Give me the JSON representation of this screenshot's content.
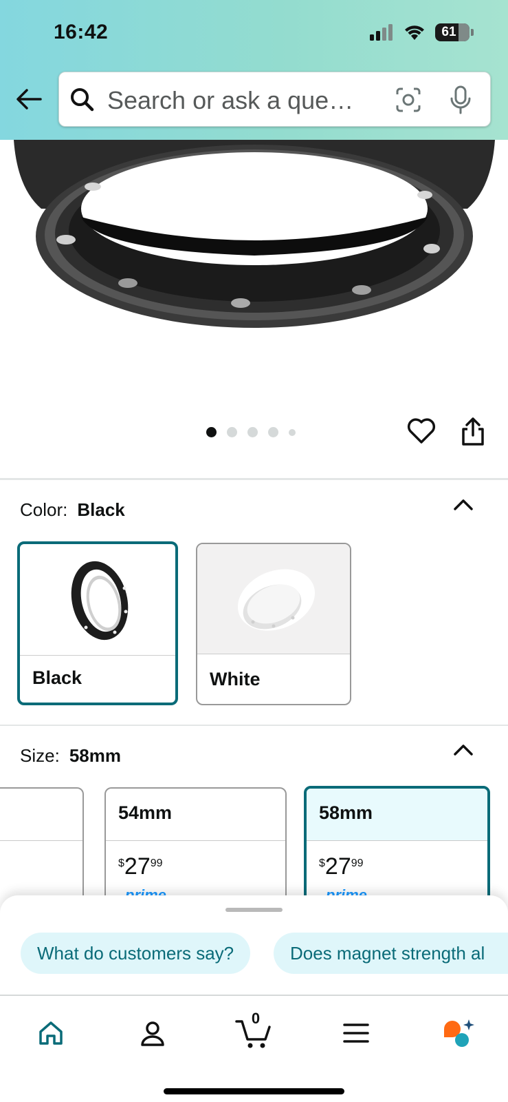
{
  "status_bar": {
    "time": "16:42",
    "battery": "61"
  },
  "search": {
    "placeholder": "Search or ask a que…"
  },
  "gallery": {
    "total_images": 5,
    "active_index": 0
  },
  "color": {
    "label": "Color:",
    "selected": "Black",
    "options": [
      {
        "label": "Black",
        "selected": true
      },
      {
        "label": "White",
        "selected": false
      }
    ]
  },
  "size": {
    "label": "Size:",
    "selected": "58mm",
    "options": [
      {
        "label": "",
        "selected": false
      },
      {
        "label": "54mm",
        "price_symbol": "$",
        "price_whole": "27",
        "price_fraction": "99",
        "prime": "prime",
        "selected": false
      },
      {
        "label": "58mm",
        "price_symbol": "$",
        "price_whole": "27",
        "price_fraction": "99",
        "prime": "prime",
        "selected": true
      }
    ]
  },
  "suggestions": [
    "What do customers say?",
    "Does magnet strength al"
  ],
  "bottom_nav": {
    "items": [
      "home-icon",
      "account-icon",
      "cart-icon",
      "menu-icon",
      "rufus-icon"
    ],
    "cart_count": "0"
  },
  "colors": {
    "accent": "#0a6b78",
    "header_gradient_start": "#84d7df",
    "header_gradient_end": "#a6e3d0",
    "chip_bg": "#dff6fa",
    "rufus_orange": "#ff6a13"
  }
}
